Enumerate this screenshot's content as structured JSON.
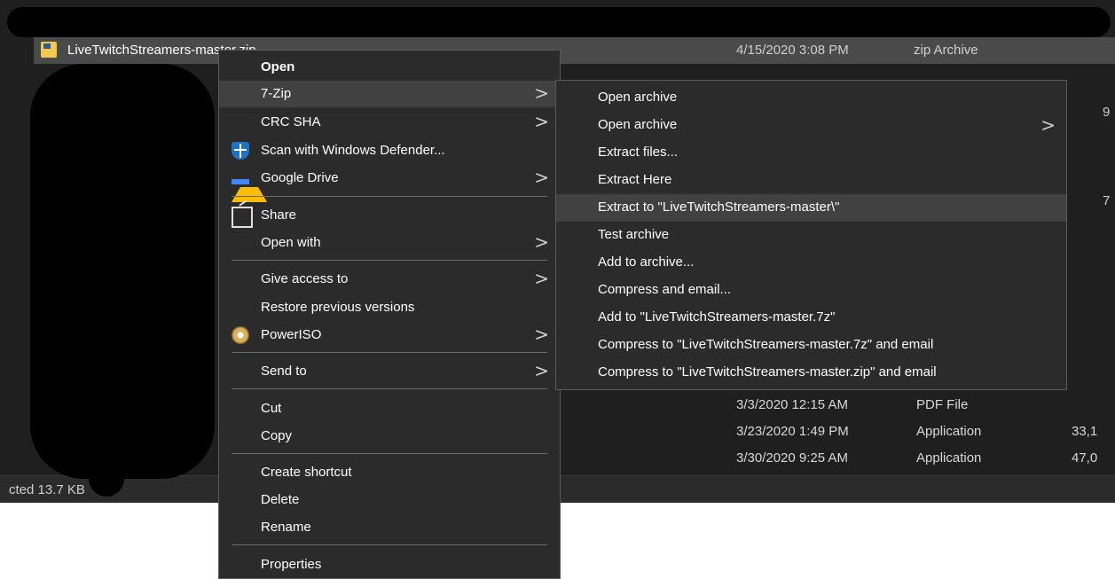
{
  "explorer": {
    "selected_file": {
      "name": "LiveTwitchStreamers-master.zip",
      "date": "4/15/2020 3:08 PM",
      "type": "zip Archive"
    },
    "rows": [
      {
        "date": "3/3/2020 12:15 AM",
        "type": "PDF File",
        "size": ""
      },
      {
        "date": "3/23/2020 1:49 PM",
        "type": "Application",
        "size": "33,1"
      },
      {
        "date": "3/30/2020 9:25 AM",
        "type": "Application",
        "size": "47,0"
      }
    ],
    "side_sizes": [
      "9",
      "7"
    ],
    "status_text": "cted  13.7 KB"
  },
  "context_menu": {
    "items": [
      {
        "label": "Open",
        "bold": true
      },
      {
        "label": "7-Zip",
        "has_submenu": true,
        "hover": true
      },
      {
        "label": "CRC SHA",
        "has_submenu": true
      },
      {
        "label": "Scan with Windows Defender...",
        "icon": "windows-defender-shield-icon"
      },
      {
        "label": "Google Drive",
        "has_submenu": true,
        "icon": "google-drive-icon"
      },
      {
        "label": "Share",
        "icon": "share-icon"
      },
      {
        "label": "Open with",
        "has_submenu": true
      },
      {
        "label": "Give access to",
        "has_submenu": true
      },
      {
        "label": "Restore previous versions"
      },
      {
        "label": "PowerISO",
        "has_submenu": true,
        "icon": "poweriso-disc-icon"
      },
      {
        "label": "Send to",
        "has_submenu": true
      },
      {
        "label": "Cut"
      },
      {
        "label": "Copy"
      },
      {
        "label": "Create shortcut"
      },
      {
        "label": "Delete"
      },
      {
        "label": "Rename"
      },
      {
        "label": "Properties"
      }
    ]
  },
  "submenu_7zip": {
    "items": [
      {
        "label": "Open archive"
      },
      {
        "label": "Open archive",
        "has_submenu": true
      },
      {
        "label": "Extract files..."
      },
      {
        "label": "Extract Here"
      },
      {
        "label": "Extract to \"LiveTwitchStreamers-master\\\"",
        "hover": true
      },
      {
        "label": "Test archive"
      },
      {
        "label": "Add to archive..."
      },
      {
        "label": "Compress and email..."
      },
      {
        "label": "Add to \"LiveTwitchStreamers-master.7z\""
      },
      {
        "label": "Compress to \"LiveTwitchStreamers-master.7z\" and email"
      },
      {
        "label": "Compress to \"LiveTwitchStreamers-master.zip\" and email"
      }
    ]
  },
  "arrow_glyph": ">",
  "colors": {
    "menu_bg": "#2b2b2b",
    "hover_bg": "#414141",
    "window_bg": "#1f1f1f"
  }
}
